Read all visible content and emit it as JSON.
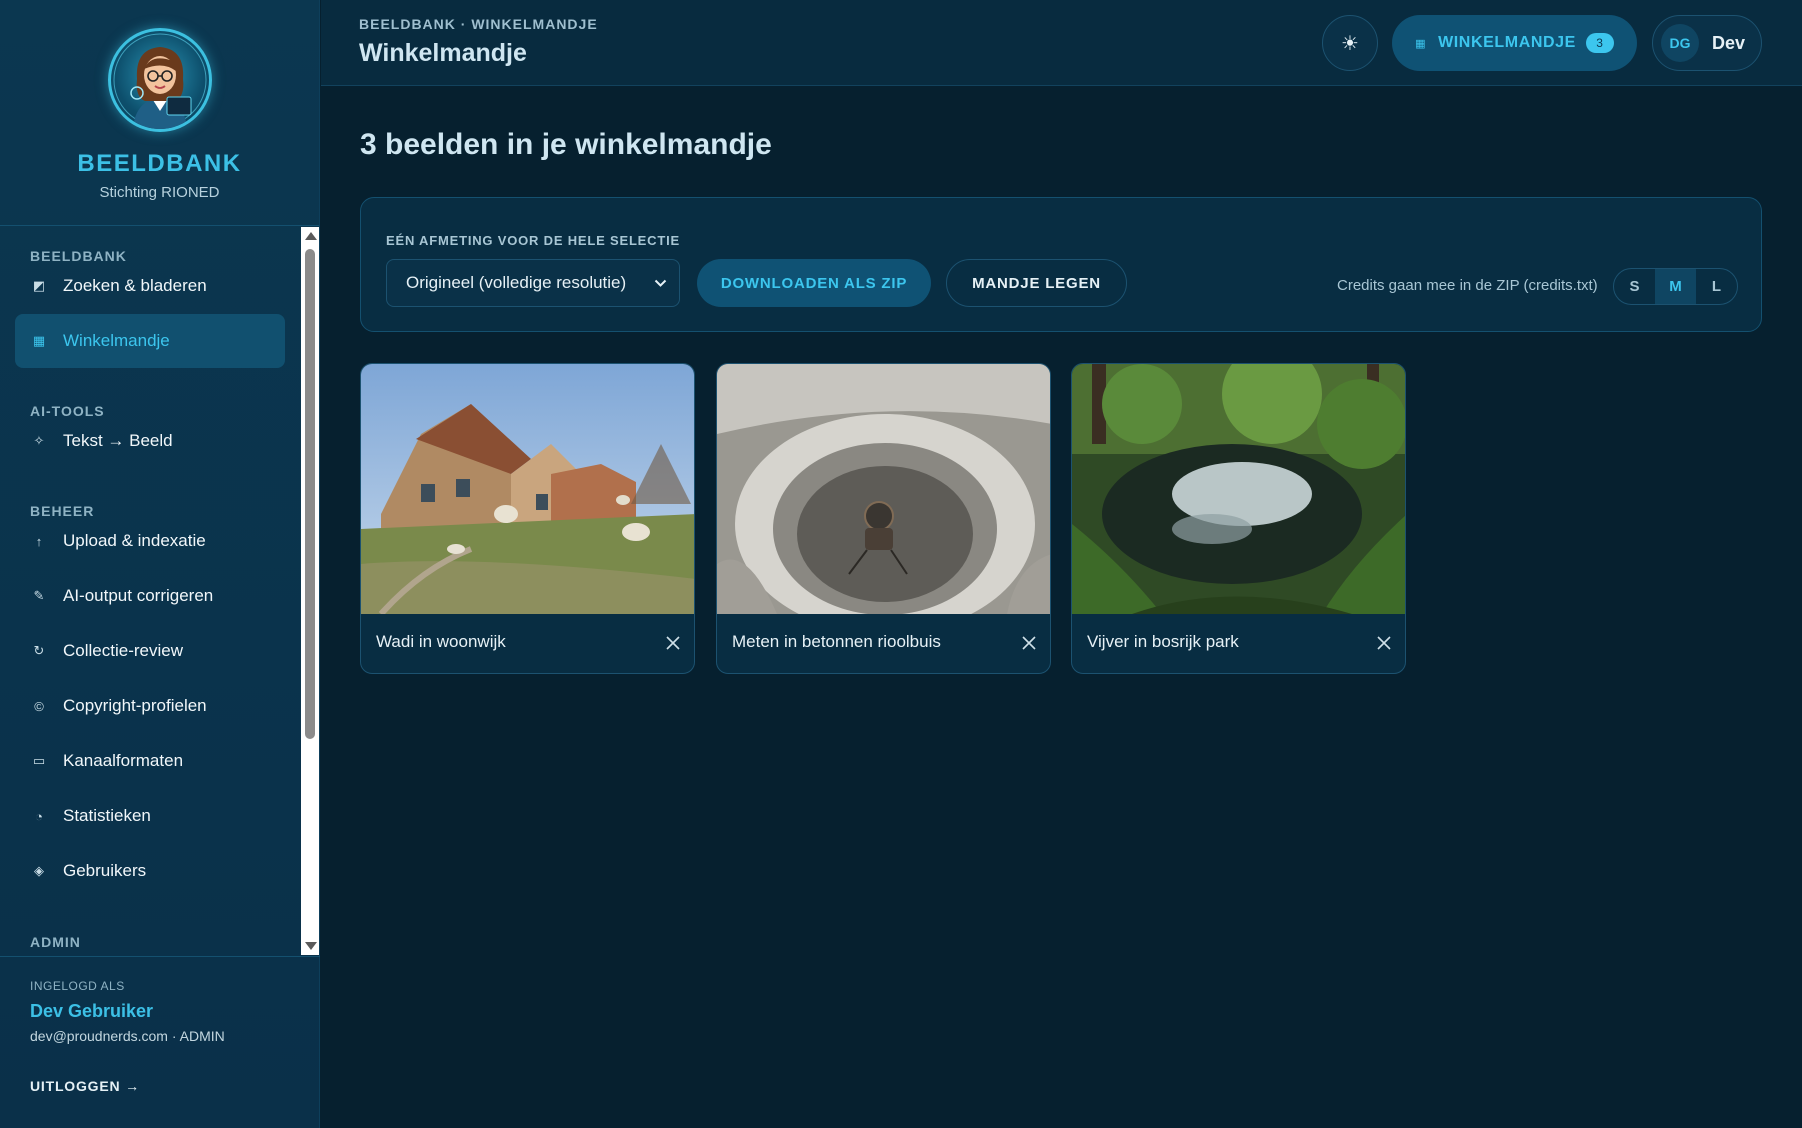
{
  "brand": {
    "title": "BEELDBANK",
    "subtitle": "Stichting RIONED",
    "logo_icon": "librarian-avatar-icon"
  },
  "sidebar": {
    "sections": [
      {
        "title": "BEELDBANK"
      },
      {
        "title": "AI-TOOLS"
      },
      {
        "title": "BEHEER"
      },
      {
        "title": "ADMIN"
      }
    ],
    "items": [
      {
        "label": "Zoeken & bladeren",
        "icon": "◩",
        "active": false
      },
      {
        "label": "Winkelmandje",
        "icon": "▦",
        "active": true
      },
      {
        "label": "Tekst → Beeld",
        "icon": "✧",
        "active": false
      },
      {
        "label": "Upload & indexatie",
        "icon": "↑",
        "active": false
      },
      {
        "label": "AI-output corrigeren",
        "icon": "✎",
        "active": false
      },
      {
        "label": "Collectie-review",
        "icon": "↻",
        "active": false
      },
      {
        "label": "Copyright-profielen",
        "icon": "©",
        "active": false
      },
      {
        "label": "Kanaalformaten",
        "icon": "▭",
        "active": false
      },
      {
        "label": "Statistieken",
        "icon": "◔",
        "active": false
      },
      {
        "label": "Gebruikers",
        "icon": "◈",
        "active": false
      }
    ]
  },
  "user_box": {
    "label": "INGELOGD ALS",
    "name": "Dev Gebruiker",
    "email_role": "dev@proudnerds.com · ADMIN",
    "logout": "UITLOGGEN →"
  },
  "topbar": {
    "breadcrumb": "BEELDBANK · WINKELMANDJE",
    "title": "Winkelmandje",
    "theme_icon": "☀",
    "cart_label": "WINKELMANDJE",
    "cart_icon": "▦",
    "cart_count": "3",
    "user_initials": "DG",
    "user_short": "Dev"
  },
  "main": {
    "heading": "3 beelden in je winkelmandje",
    "panel": {
      "label": "EÉN AFMETING VOOR DE HELE SELECTIE",
      "select_value": "Origineel (volledige resolutie)",
      "download_label": "DOWNLOADEN ALS ZIP",
      "clear_label": "MANDJE LEGEN",
      "credits_note": "Credits gaan mee in de ZIP (credits.txt)",
      "sizes": [
        {
          "label": "S",
          "active": false
        },
        {
          "label": "M",
          "active": true
        },
        {
          "label": "L",
          "active": false
        }
      ]
    },
    "cards": [
      {
        "title": "Wadi in woonwijk"
      },
      {
        "title": "Meten in betonnen rioolbuis"
      },
      {
        "title": "Vijver in bosrijk park"
      }
    ]
  },
  "colors": {
    "accent": "#3cc6ee",
    "sidebar_bg": "#0b3750",
    "page_bg": "#06202f",
    "active_item_bg": "#11506f"
  }
}
